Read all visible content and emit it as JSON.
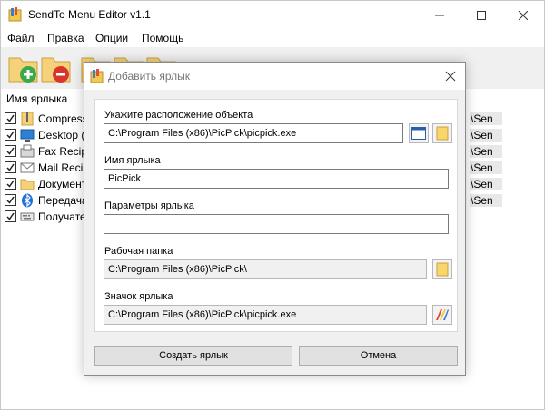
{
  "app": {
    "title": "SendTo Menu Editor v1.1",
    "menu": [
      "Файл",
      "Правка",
      "Опции",
      "Помощь"
    ]
  },
  "toolbar": {
    "buttons": [
      "add-folder-icon",
      "remove-folder-icon",
      "folder-icon",
      "folder-icon",
      "folder-icon"
    ]
  },
  "list": {
    "header": "Имя ярлыка",
    "items": [
      {
        "name": "Compresse",
        "path": "\\Sen",
        "icon": "zip-folder-icon",
        "checked": true
      },
      {
        "name": "Desktop (c",
        "path": "\\Sen",
        "icon": "desktop-icon",
        "checked": true
      },
      {
        "name": "Fax Recipie",
        "path": "\\Sen",
        "icon": "fax-icon",
        "checked": true
      },
      {
        "name": "Mail Recipie",
        "path": "\\Sen",
        "icon": "mail-icon",
        "checked": true
      },
      {
        "name": "Документ",
        "path": "\\Sen",
        "icon": "folder-icon",
        "checked": true
      },
      {
        "name": "Передача",
        "path": "\\Sen",
        "icon": "bluetooth-icon",
        "checked": true
      },
      {
        "name": "Получател",
        "path": "",
        "icon": "keyboard-icon",
        "checked": true
      }
    ]
  },
  "dialog": {
    "title": "Добавить ярлык",
    "location_label": "Укажите расположение объекта",
    "location_value": "C:\\Program Files (x86)\\PicPick\\picpick.exe",
    "name_label": "Имя ярлыка",
    "name_value": "PicPick",
    "params_label": "Параметры ярлыка",
    "params_value": "",
    "workdir_label": "Рабочая папка",
    "workdir_value": "C:\\Program Files (x86)\\PicPick\\",
    "icon_label": "Значок ярлыка",
    "icon_value": "C:\\Program Files (x86)\\PicPick\\picpick.exe",
    "create_button": "Создать ярлык",
    "cancel_button": "Отмена"
  }
}
